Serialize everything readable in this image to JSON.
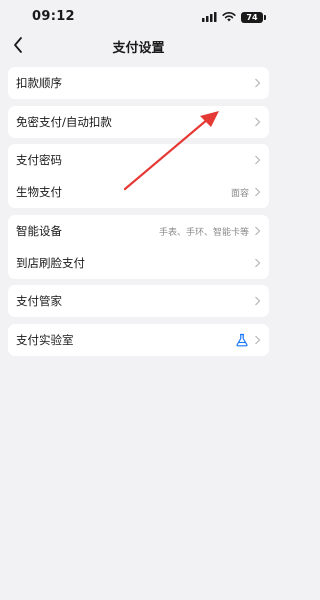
{
  "status": {
    "time": "09:12",
    "battery": "74"
  },
  "header": {
    "title": "支付设置"
  },
  "sections": [
    {
      "rows": [
        {
          "label": "扣款顺序",
          "value": ""
        }
      ]
    },
    {
      "rows": [
        {
          "label": "免密支付/自动扣款",
          "value": ""
        }
      ]
    },
    {
      "rows": [
        {
          "label": "支付密码",
          "value": ""
        },
        {
          "label": "生物支付",
          "value": "面容"
        }
      ]
    },
    {
      "rows": [
        {
          "label": "智能设备",
          "value": "手表、手环、智能卡等"
        },
        {
          "label": "到店刷脸支付",
          "value": ""
        }
      ]
    },
    {
      "rows": [
        {
          "label": "支付管家",
          "value": ""
        }
      ]
    },
    {
      "rows": [
        {
          "label": "支付实验室",
          "value": ""
        }
      ]
    }
  ],
  "icons": {
    "back": "back-icon",
    "chevron": "chevron-right-icon",
    "lab": "flask-icon",
    "signal": "signal-icon",
    "wifi": "wifi-icon",
    "battery": "battery-icon"
  },
  "colors": {
    "background": "#f2f2f4",
    "card": "#ffffff",
    "accent": "#1677ff",
    "annotation_arrow": "#e53935"
  }
}
